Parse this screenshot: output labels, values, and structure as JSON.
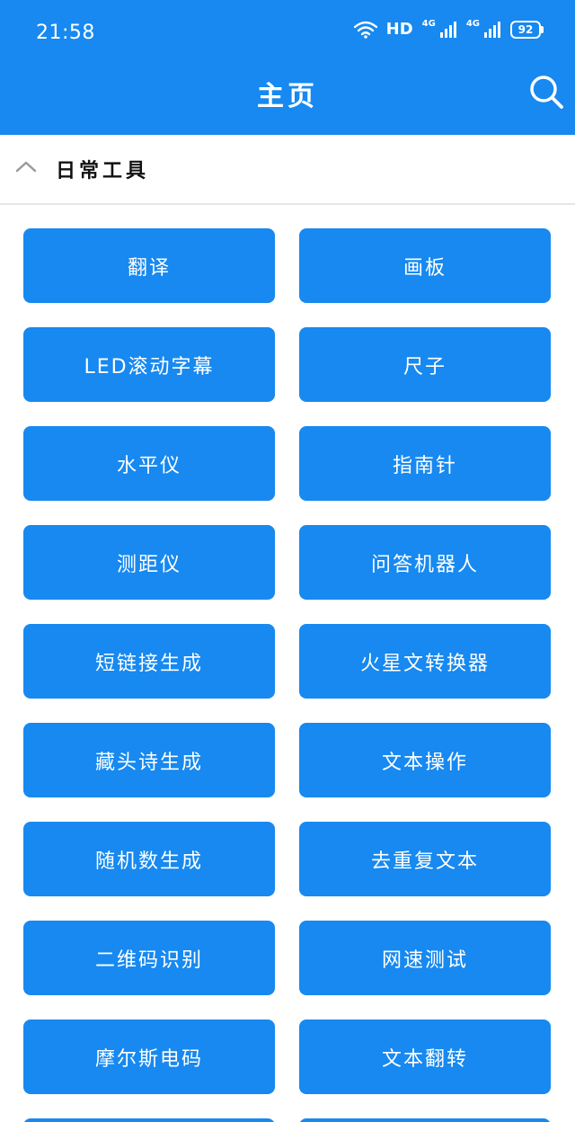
{
  "status_bar": {
    "time": "21:58",
    "network": "HD",
    "signal1_label": "4G",
    "signal2_label": "4G",
    "battery": "92"
  },
  "header": {
    "title": "主页",
    "search_icon": "search-icon"
  },
  "section": {
    "title": "日常工具",
    "collapse_icon": "chevron-up-icon"
  },
  "tools": [
    {
      "label": "翻译"
    },
    {
      "label": "画板"
    },
    {
      "label": "LED滚动字幕"
    },
    {
      "label": "尺子"
    },
    {
      "label": "水平仪"
    },
    {
      "label": "指南针"
    },
    {
      "label": "测距仪"
    },
    {
      "label": "问答机器人"
    },
    {
      "label": "短链接生成"
    },
    {
      "label": "火星文转换器"
    },
    {
      "label": "藏头诗生成"
    },
    {
      "label": "文本操作"
    },
    {
      "label": "随机数生成"
    },
    {
      "label": "去重复文本"
    },
    {
      "label": "二维码识别"
    },
    {
      "label": "网速测试"
    },
    {
      "label": "摩尔斯电码"
    },
    {
      "label": "文本翻转"
    }
  ],
  "colors": {
    "primary": "#1789f0",
    "text_on_primary": "#ffffff",
    "divider": "#e6e6e6"
  }
}
